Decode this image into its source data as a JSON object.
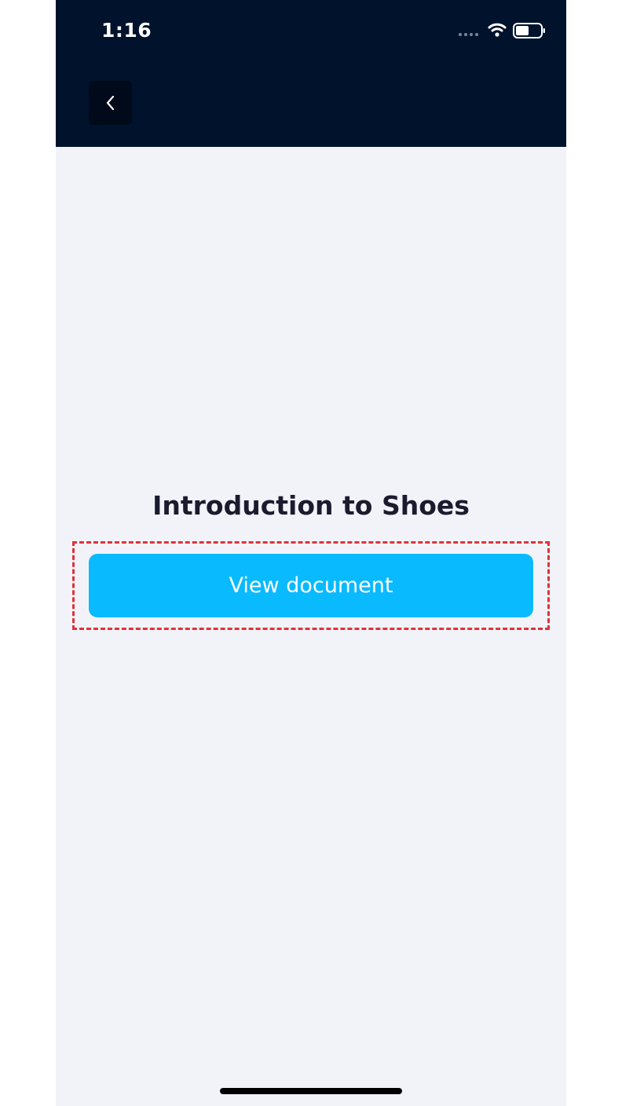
{
  "status_bar": {
    "time": "1:16",
    "wifi_icon": "wifi-icon",
    "battery_icon": "battery-icon"
  },
  "header": {
    "back_icon": "chevron-left-icon",
    "background_color": "#00122c"
  },
  "main": {
    "title": "Introduction to Shoes",
    "view_button_label": "View document",
    "accent_color": "#09baff",
    "highlight_color": "#e0323a"
  }
}
